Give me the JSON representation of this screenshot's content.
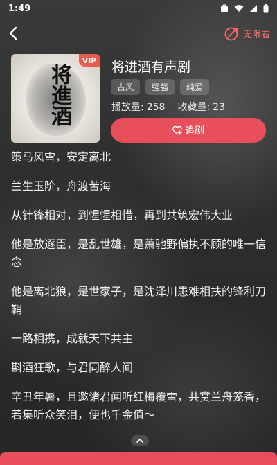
{
  "status_bar": {
    "time": "1:49"
  },
  "header": {
    "unlimited_label": "无限看"
  },
  "cover": {
    "title": "将進酒",
    "vip_badge": "VIP"
  },
  "drama": {
    "title": "将进酒有声剧",
    "tags": [
      "古风",
      "强强",
      "纯爱"
    ],
    "play_count_label": "播放量:",
    "play_count": "258",
    "collect_count_label": "收藏量:",
    "collect_count": "23",
    "follow_label": "追剧"
  },
  "intro": {
    "paragraphs": [
      "策马风雪，安定离北",
      "兰生玉阶，舟渡苦海",
      "从针锋相对，到惺惺相惜，再到共筑宏伟大业",
      "他是放逐臣，是乱世雄，是萧驰野偏执不顾的唯一信念",
      "他是离北狼，是世家子，是沈泽川患难相扶的锋利刀鞘",
      "一路相携，成就天下共主",
      "斟酒狂歌，与君同醉人间",
      "辛丑年暑，且邀诸君闻听红梅覆雪，共赏兰舟笼香，若集听众笑泪，便也千金值〜"
    ]
  },
  "colors": {
    "accent": "#e7505b",
    "unlimited": "#ff6b6b"
  }
}
